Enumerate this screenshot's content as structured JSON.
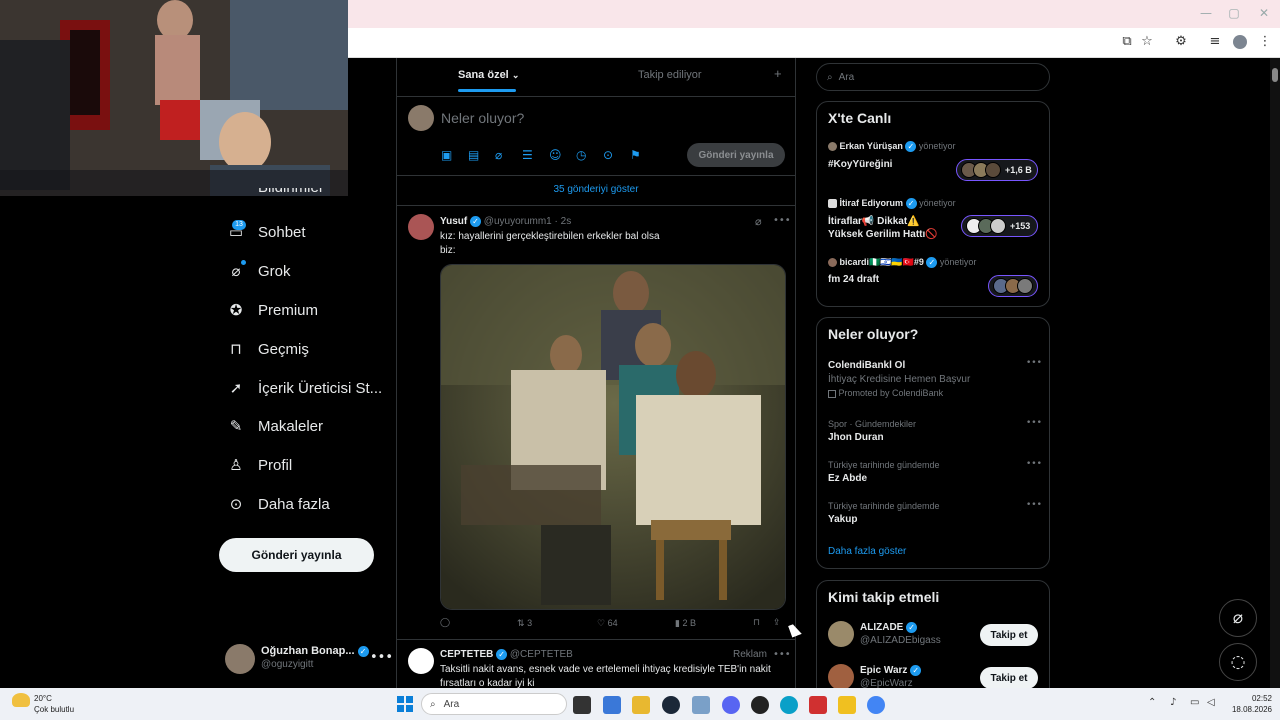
{
  "left_nav": {
    "partial_item": "Bildirimler",
    "chat_badge": "13",
    "items": [
      {
        "label": "Sohbet",
        "icon": "chat-icon"
      },
      {
        "label": "Grok",
        "icon": "grok-icon"
      },
      {
        "label": "Premium",
        "icon": "premium-icon"
      },
      {
        "label": "Geçmiş",
        "icon": "bookmark-icon"
      },
      {
        "label": "İçerik Üreticisi St...",
        "icon": "rocket-icon"
      },
      {
        "label": "Makaleler",
        "icon": "article-icon"
      },
      {
        "label": "Profil",
        "icon": "profile-icon"
      },
      {
        "label": "Daha fazla",
        "icon": "more-circle-icon"
      }
    ],
    "post_button": "Gönderi yayınla",
    "account": {
      "name": "Oğuzhan Bonap...",
      "handle": "@oguzyigitt"
    }
  },
  "tabs": {
    "for_you": "Sana özel",
    "following": "Takip ediliyor",
    "add": "+"
  },
  "composer": {
    "placeholder": "Neler oluyor?",
    "post_button": "Gönderi yayınla"
  },
  "show_posts": "35 gönderiyi göster",
  "tweet": {
    "name": "Yusuf",
    "handle": "@uyuyorumm1",
    "time": "· 2s",
    "text_line1": "kız: hayallerini gerçekleştirebilen erkekler bal olsa",
    "text_line2": "biz:",
    "replies": "",
    "retweets": "3",
    "likes": "64",
    "views": "2 B"
  },
  "ad_tweet": {
    "name": "CEPTETEB",
    "handle": "@CEPTETEB",
    "label": "Reklam",
    "text_line1": "Taksitli nakit avans, esnek vade ve ertelemeli ihtiyaç kredisiyle TEB'in nakit",
    "text_line2": "fırsatları o kadar iyi ki"
  },
  "search": {
    "placeholder": "Ara"
  },
  "live": {
    "title": "X'te Canlı",
    "spaces": [
      {
        "host": "Erkan Yürüşan",
        "status": "yönetiyor",
        "title1": "#KoyYüreğini",
        "title2": "",
        "count": "+1,6 B"
      },
      {
        "host": "İtiraf Ediyorum",
        "status": "yönetiyor",
        "title1": "İtiraflar📢 Dikkat⚠️",
        "title2": "Yüksek Gerilim Hattı🚫",
        "count": "+153"
      },
      {
        "host": "bicardi🇳🇬🇮🇱🇺🇦🇹🇷#9",
        "status": "yönetiyor",
        "title1": "fm 24 draft",
        "title2": "",
        "count": ""
      }
    ]
  },
  "trends": {
    "title": "Neler oluyor?",
    "promoted": {
      "name": "ColendiBankl Ol",
      "desc": "İhtiyaç Kredisine Hemen Başvur",
      "by": "Promoted by ColendiBank"
    },
    "items": [
      {
        "context": "Spor · Gündemdekiler",
        "name": "Jhon Duran"
      },
      {
        "context": "Türkiye tarihinde gündemde",
        "name": "Ez Abde"
      },
      {
        "context": "Türkiye tarihinde gündemde",
        "name": "Yakup"
      }
    ],
    "show_more": "Daha fazla göster"
  },
  "who_to_follow": {
    "title": "Kimi takip etmeli",
    "users": [
      {
        "name": "ALIZADE",
        "handle": "@ALIZADEbigass",
        "button": "Takip et"
      },
      {
        "name": "Epic Warz",
        "handle": "@EpicWarz",
        "button": "Takip et"
      }
    ]
  },
  "taskbar": {
    "weather_temp": "20°C",
    "weather_desc": "Çok bulutlu",
    "search_placeholder": "Ara",
    "time": "02:52",
    "date": "18.08.2026"
  },
  "colors": {
    "accent": "#1d9bf0",
    "background": "#000000",
    "border": "#2f3336",
    "live_border": "#7856ff"
  }
}
